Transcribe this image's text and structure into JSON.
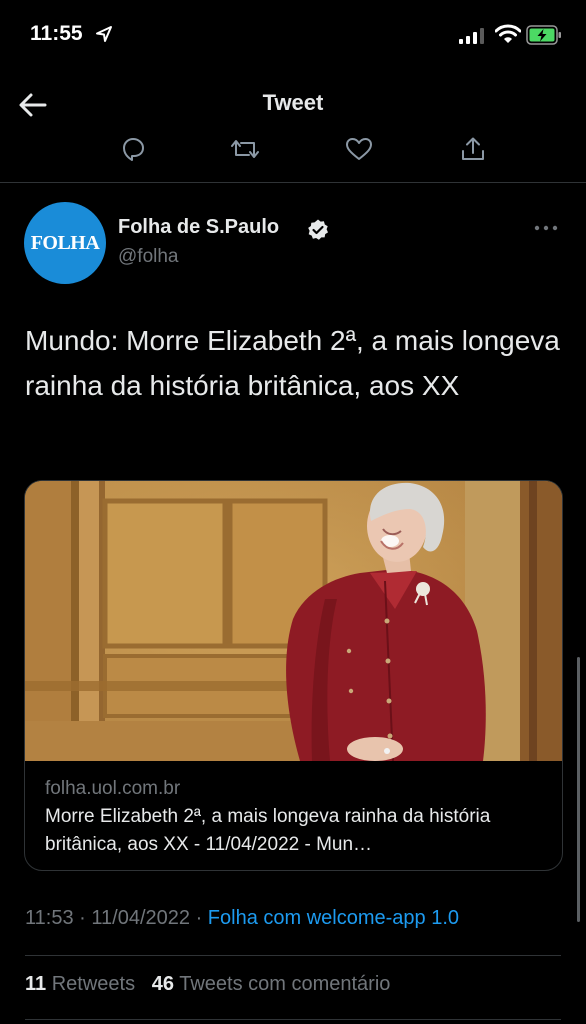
{
  "status_bar": {
    "time": "11:55"
  },
  "header": {
    "title": "Tweet"
  },
  "tweet": {
    "display_name": "Folha de S.Paulo",
    "handle": "@folha",
    "avatar_text": "FOLHA",
    "text": "Mundo: Morre Elizabeth 2ª, a mais longeva rainha da história britânica, aos XX",
    "card": {
      "domain": "folha.uol.com.br",
      "title": "Morre Elizabeth 2ª, a mais longeva rainha da história britânica, aos XX - 11/04/2022 - Mun…"
    },
    "time": "11:53",
    "date": "11/04/2022",
    "source": "Folha com welcome-app 1.0",
    "retweets_count": "11",
    "retweets_label": "Retweets",
    "quotes_count": "46",
    "quotes_label": "Tweets com comentário"
  },
  "icons": {
    "back": "arrow-left-icon",
    "actions": [
      "reply-icon",
      "retweet-icon",
      "like-icon",
      "share-icon"
    ],
    "verified": "verified-badge-icon",
    "more": "more-options-icon"
  },
  "colors": {
    "background": "#000000",
    "text_primary": "#e7e9ea",
    "text_secondary": "#71767b",
    "link": "#1d9bf0",
    "brand_avatar": "#1a8cd8",
    "battery": "#4cd964"
  }
}
